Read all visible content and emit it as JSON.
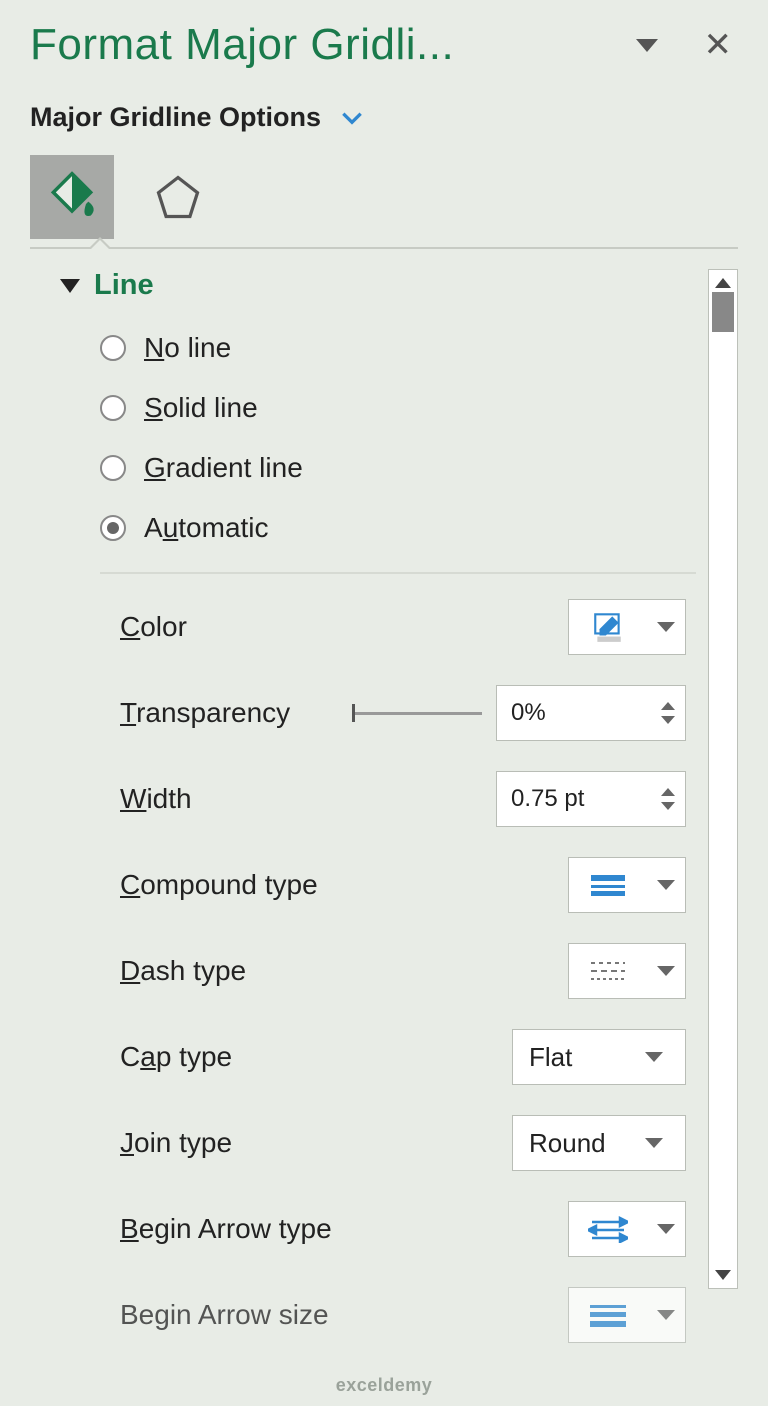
{
  "header": {
    "title": "Format Major Gridli...",
    "subtitle": "Major Gridline Options"
  },
  "section": {
    "title": "Line",
    "radios": [
      {
        "pre": "",
        "u": "N",
        "post": "o line"
      },
      {
        "pre": "",
        "u": "S",
        "post": "olid line"
      },
      {
        "pre": "",
        "u": "G",
        "post": "radient line"
      },
      {
        "pre": "A",
        "u": "u",
        "post": "tomatic"
      }
    ],
    "props": {
      "color": {
        "pre": "",
        "u": "C",
        "post": "olor"
      },
      "transparency": {
        "pre": "",
        "u": "T",
        "post": "ransparency",
        "value": "0%"
      },
      "width": {
        "pre": "",
        "u": "W",
        "post": "idth",
        "value": "0.75 pt"
      },
      "compound": {
        "pre": "",
        "u": "C",
        "post": "ompound type"
      },
      "dash": {
        "pre": "",
        "u": "D",
        "post": "ash type"
      },
      "cap": {
        "pre": "C",
        "u": "a",
        "post": "p type",
        "value": "Flat"
      },
      "join": {
        "pre": "",
        "u": "J",
        "post": "oin type",
        "value": "Round"
      },
      "beginArrow": {
        "pre": "",
        "u": "B",
        "post": "egin Arrow type"
      },
      "beginSize": {
        "pre": "Be",
        "u": "g",
        "post": "in Arrow size"
      }
    }
  },
  "watermark": "exceldemy"
}
